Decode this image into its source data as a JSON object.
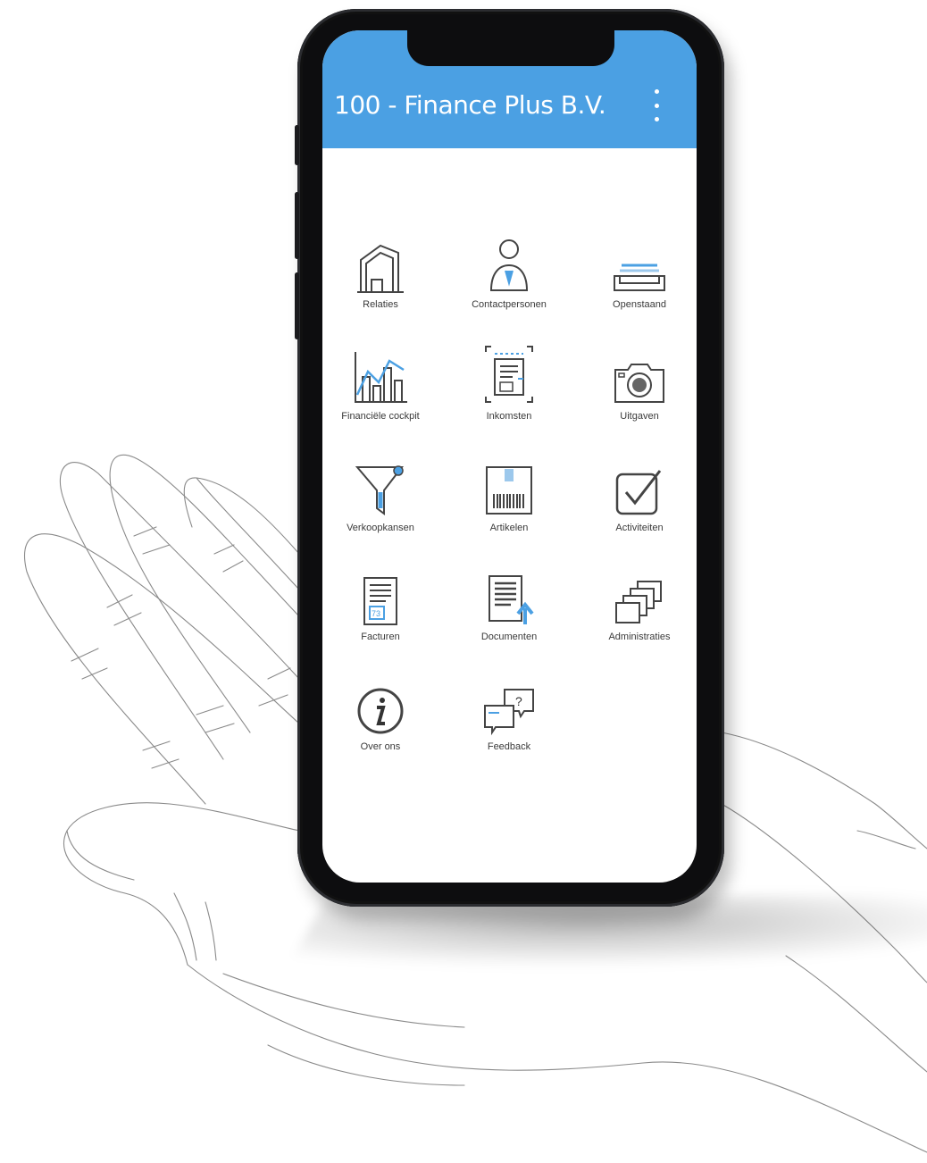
{
  "app": {
    "title": "100 - Finance Plus B.V.",
    "accent_color": "#4ba0e3"
  },
  "menu": {
    "icon": "more-vert-icon"
  },
  "tiles": [
    {
      "label": "Relaties",
      "icon": "building-icon"
    },
    {
      "label": "Contactpersonen",
      "icon": "person-icon"
    },
    {
      "label": "Openstaand",
      "icon": "tray-icon"
    },
    {
      "label": "Financiële cockpit",
      "icon": "chart-icon"
    },
    {
      "label": "Inkomsten",
      "icon": "scan-invoice-icon"
    },
    {
      "label": "Uitgaven",
      "icon": "camera-icon"
    },
    {
      "label": "Verkoopkansen",
      "icon": "funnel-icon"
    },
    {
      "label": "Artikelen",
      "icon": "barcode-icon"
    },
    {
      "label": "Activiteiten",
      "icon": "checkbox-icon"
    },
    {
      "label": "Facturen",
      "icon": "invoice-icon"
    },
    {
      "label": "Documenten",
      "icon": "document-upload-icon"
    },
    {
      "label": "Administraties",
      "icon": "stacked-windows-icon"
    },
    {
      "label": "Over ons",
      "icon": "info-icon"
    },
    {
      "label": "Feedback",
      "icon": "chat-question-icon"
    }
  ]
}
